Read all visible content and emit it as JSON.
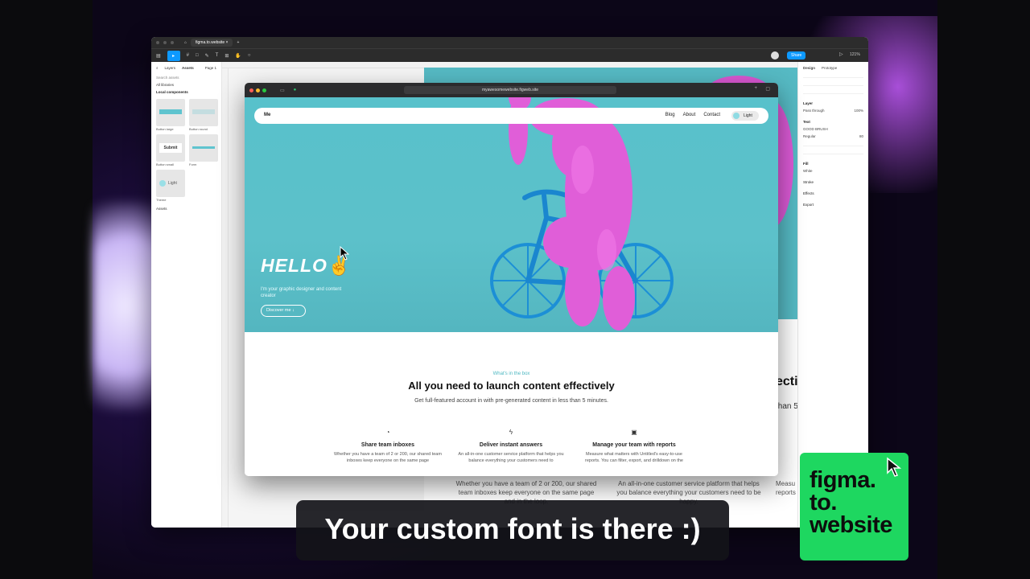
{
  "figma": {
    "tab_label": "figma.to.website",
    "page_label": "Page 1",
    "share_label": "Share",
    "zoom_label": "121%",
    "left_panel": {
      "tab_layers": "Layers",
      "tab_assets": "Assets",
      "search_placeholder": "Search assets",
      "library": "All libraries",
      "section": "Local components",
      "components": [
        "Button large",
        "Button round",
        "Button small",
        "Form",
        "Theme"
      ],
      "submit_label": "Submit",
      "light_label": "Light",
      "assets_label": "Assets"
    },
    "right_panel": {
      "tab_design": "Design",
      "tab_prototype": "Prototype",
      "layer": "Layer",
      "layer_mode": "Pass through",
      "layer_opacity": "100%",
      "text": "Text",
      "font": "GOOD BRUSH",
      "weight": "Regular",
      "size": "80",
      "fill": "Fill",
      "fill_value": "White",
      "stroke": "Stroke",
      "effects": "Effects",
      "export": "Export"
    },
    "bg_heading": "ecti",
    "bg_sub": "than 5",
    "bg_col1": "Whether you have a team of 2 or 200, our shared team inboxes keep everyone on the same page and in the loop.",
    "bg_col2": "An all-in-one customer service platform that helps you balance everything your customers need to be happy.",
    "bg_col3": "Measu reports"
  },
  "browser": {
    "url": "myawesomewebsite.figweb.site",
    "nav_brand": "Me",
    "nav_links": [
      "Blog",
      "About",
      "Contact"
    ],
    "theme_label": "Light",
    "hero_title": "HELLO",
    "hero_emoji": "✌",
    "hero_subtitle": "I'm your graphic designer and content creator",
    "cta_label": "Discover me",
    "eyebrow": "What's in the box",
    "heading": "All you need to launch content effectively",
    "subheading": "Get full-featured account in with pre-generated content in less than 5 minutes.",
    "features": [
      {
        "title": "Share team inboxes",
        "desc": "Whether you have a team of 2 or 200, our shared team inboxes keep everyone on the same page"
      },
      {
        "title": "Deliver instant answers",
        "desc": "An all-in-one customer service platform that helps you balance everything your customers need to"
      },
      {
        "title": "Manage your team with reports",
        "desc": "Measure what matters with Untitled's easy-to-use reports. You can filter, export, and drilldown on the"
      }
    ]
  },
  "caption": "Your custom font is there :)",
  "logo_lines": [
    "figma.",
    "to.",
    "website"
  ],
  "colors": {
    "accent": "#0d99ff",
    "teal": "#58c1cb",
    "logo_green": "#1ed760",
    "bear_pink": "#e05ed8"
  }
}
